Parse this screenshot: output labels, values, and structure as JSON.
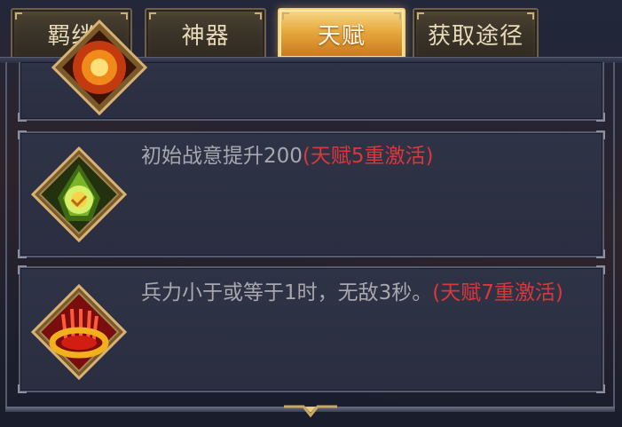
{
  "tabs": [
    {
      "label": "羁绊",
      "active": false
    },
    {
      "label": "神器",
      "active": false
    },
    {
      "label": "天赋",
      "active": true
    },
    {
      "label": "获取途径",
      "active": false
    }
  ],
  "talents": [
    {
      "icon": "fire-talent-icon",
      "text": "",
      "highlight": ""
    },
    {
      "icon": "green-shield-talent-icon",
      "text": "初始战意提升200",
      "highlight": "(天赋5重激活)"
    },
    {
      "icon": "red-ring-talent-icon",
      "text": "兵力小于或等于1时，无敌3秒。",
      "highlight": "(天赋7重激活)"
    }
  ],
  "colors": {
    "text": "#a7a7ad",
    "highlight": "#d8383b",
    "active_tab": "#e8a93e",
    "panel_bg": "#2c3043"
  }
}
